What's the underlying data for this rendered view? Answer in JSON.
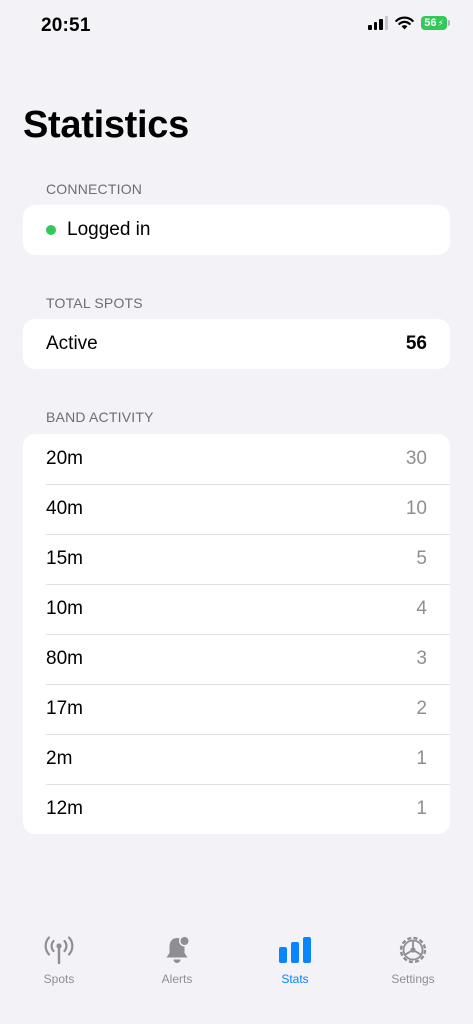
{
  "status_bar": {
    "time": "20:51",
    "battery": "56"
  },
  "page": {
    "title": "Statistics"
  },
  "connection": {
    "header": "CONNECTION",
    "status": "Logged in",
    "status_color": "#34c759"
  },
  "total_spots": {
    "header": "TOTAL SPOTS",
    "label": "Active",
    "value": "56"
  },
  "band_activity": {
    "header": "BAND ACTIVITY",
    "rows": [
      {
        "band": "20m",
        "count": "30"
      },
      {
        "band": "40m",
        "count": "10"
      },
      {
        "band": "15m",
        "count": "5"
      },
      {
        "band": "10m",
        "count": "4"
      },
      {
        "band": "80m",
        "count": "3"
      },
      {
        "band": "17m",
        "count": "2"
      },
      {
        "band": "2m",
        "count": "1"
      },
      {
        "band": "12m",
        "count": "1"
      }
    ]
  },
  "tab_bar": {
    "accent": "#0a84ff",
    "tabs": [
      {
        "label": "Spots",
        "icon": "antenna-icon"
      },
      {
        "label": "Alerts",
        "icon": "bell-badge-icon"
      },
      {
        "label": "Stats",
        "icon": "bar-chart-icon",
        "active": true
      },
      {
        "label": "Settings",
        "icon": "gear-icon"
      }
    ]
  }
}
